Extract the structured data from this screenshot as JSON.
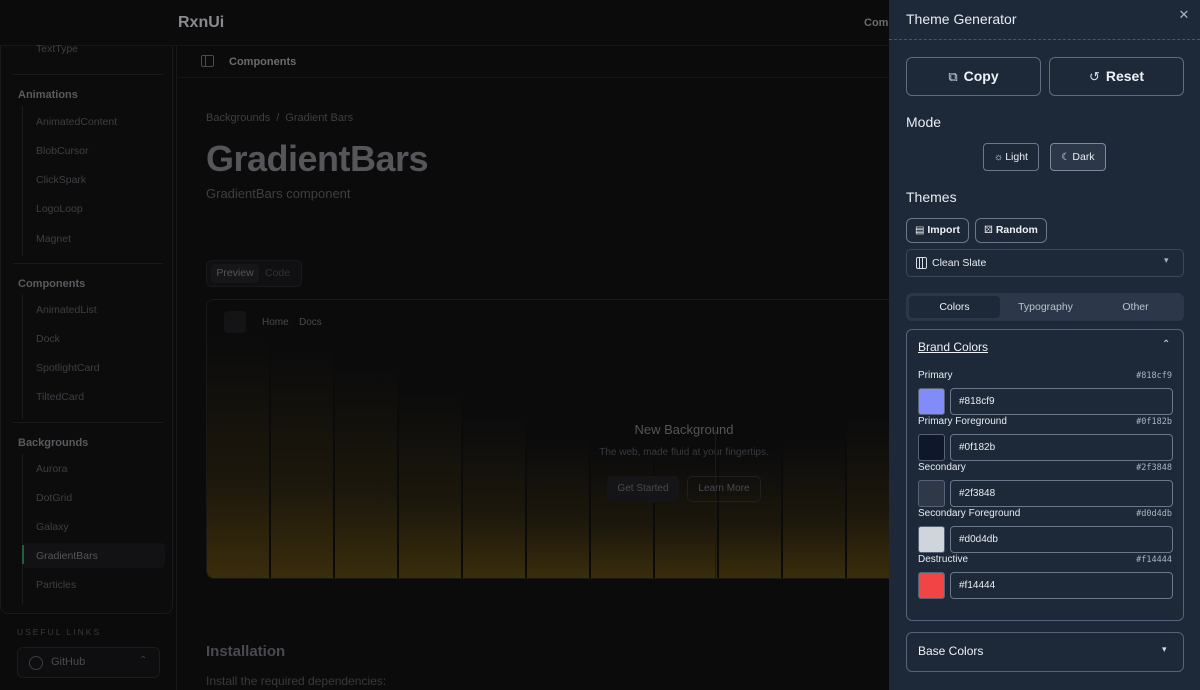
{
  "app": {
    "brand": "RxnUi",
    "topbar_link": "Comp"
  },
  "sidebar": {
    "top_item": "TextType",
    "sections": [
      {
        "title": "Animations",
        "items": [
          "AnimatedContent",
          "BlobCursor",
          "ClickSpark",
          "LogoLoop",
          "Magnet"
        ]
      },
      {
        "title": "Components",
        "items": [
          "AnimatedList",
          "Dock",
          "SpotlightCard",
          "TiltedCard"
        ]
      },
      {
        "title": "Backgrounds",
        "items": [
          "Aurora",
          "DotGrid",
          "Galaxy",
          "GradientBars",
          "Particles"
        ]
      }
    ],
    "useful_links_label": "USEFUL LINKS",
    "github_label": "GitHub"
  },
  "content": {
    "header_title": "Components",
    "breadcrumb": [
      "Backgrounds",
      "/",
      "Gradient Bars"
    ],
    "title": "GradientBars",
    "subtitle": "GradientBars component",
    "tabs": [
      "Preview",
      "Code"
    ],
    "preview": {
      "nav": [
        "Home",
        "Docs"
      ],
      "heading": "New Background",
      "subheading": "The web, made fluid at your fingertips.",
      "primary_button": "Get Started",
      "secondary_button": "Learn More"
    },
    "installation_title": "Installation",
    "installation_sub": "Install the required dependencies:"
  },
  "panel": {
    "title": "Theme Generator",
    "close_glyph": "✕",
    "copy_label": "Copy",
    "reset_label": "Reset",
    "mode_label": "Mode",
    "modes": [
      "Light",
      "Dark"
    ],
    "active_mode": "Dark",
    "themes_label": "Themes",
    "import_label": "Import",
    "random_label": "Random",
    "theme_select": "Clean Slate",
    "tabs": [
      "Colors",
      "Typography",
      "Other"
    ],
    "active_tab": "Colors",
    "brand_colors_title": "Brand Colors",
    "brand_colors": [
      {
        "label": "Primary",
        "hex": "#818cf9",
        "value": "#818cf9",
        "swatch": "#818cf9"
      },
      {
        "label": "Primary Foreground",
        "hex": "#0f182b",
        "value": "#0f182b",
        "swatch": "#0f182b"
      },
      {
        "label": "Secondary",
        "hex": "#2f3848",
        "value": "#2f3848",
        "swatch": "#2f3848"
      },
      {
        "label": "Secondary Foreground",
        "hex": "#d0d4db",
        "value": "#d0d4db",
        "swatch": "#d0d4db"
      },
      {
        "label": "Destructive",
        "hex": "#f14444",
        "value": "#f14444",
        "swatch": "#f14444"
      }
    ],
    "base_colors_title": "Base Colors"
  },
  "icons": {
    "copy": "copy-icon",
    "reset": "rotate-ccw-icon",
    "light": "sun-icon",
    "dark": "moon-icon",
    "import": "file-icon",
    "random": "dice-icon",
    "theme": "palette-icon"
  },
  "colors": {
    "panel_bg": "#1d2838",
    "accent_active": "#1f5f3a",
    "gradient_bar": "#3a2d0c"
  }
}
